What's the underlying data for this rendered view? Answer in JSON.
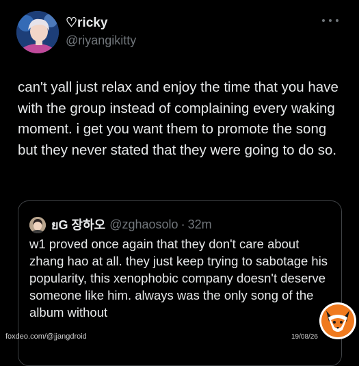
{
  "tweet": {
    "author": {
      "display_name": "♡ricky",
      "handle": "@riyangikitty",
      "avatar_icon": "profile-photo"
    },
    "more_icon": "more-options-icon",
    "text": "can't yall just relax and enjoy the time that you have with the group instead of complaining every waking moment. i get you want them to promote the song but they never stated that they were going to do so."
  },
  "quote": {
    "author": {
      "display_name": "ยG 장하오",
      "handle": "@zghaosolo",
      "avatar_icon": "profile-photo"
    },
    "separator": "·",
    "timestamp": "32m",
    "text": "w1 proved once again that they don't care about zhang hao at all. they just keep trying to sabotage his popularity, this xenophobic company doesn't deserve someone like him. always was the only song of the album without"
  },
  "watermark": {
    "source": "foxdeo.com/@jjangdroid",
    "date": "19/08/26",
    "logo_icon": "fox-logo"
  },
  "colors": {
    "background": "#000000",
    "primary_text": "#e7e9ea",
    "secondary_text": "#71767b",
    "border": "#3e4144",
    "logo_orange": "#f07a1f"
  }
}
